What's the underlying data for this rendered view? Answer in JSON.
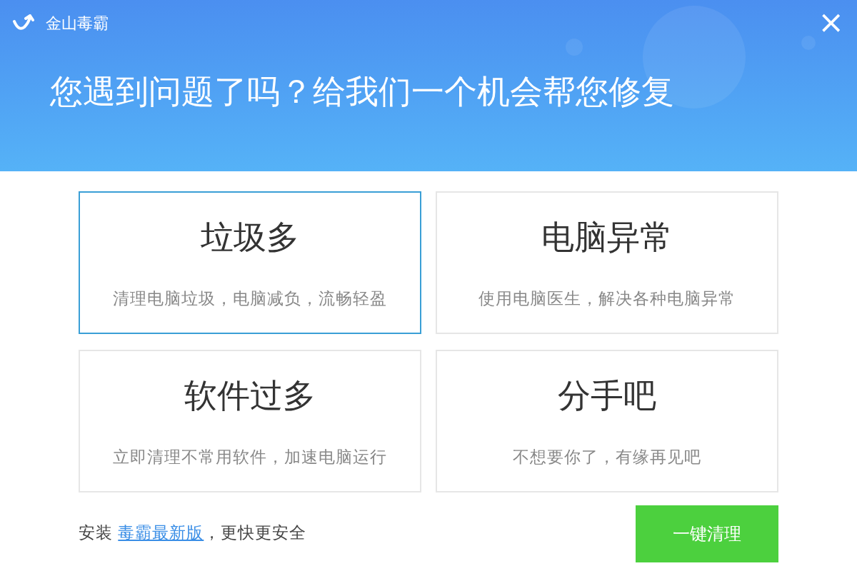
{
  "window": {
    "title": "金山毒霸",
    "close": "×"
  },
  "headline": "您遇到问题了吗？给我们一个机会帮您修复",
  "cards": [
    {
      "title": "垃圾多",
      "description": "清理电脑垃圾，电脑减负，流畅轻盈",
      "selected": true
    },
    {
      "title": "电脑异常",
      "description": "使用电脑医生，解决各种电脑异常",
      "selected": false
    },
    {
      "title": "软件过多",
      "description": "立即清理不常用软件，加速电脑运行",
      "selected": false
    },
    {
      "title": "分手吧",
      "description": "不想要你了，有缘再见吧",
      "selected": false
    }
  ],
  "footer": {
    "prefix": "安装 ",
    "link": "毒霸最新版",
    "suffix": "，更快更安全"
  },
  "button": "一键清理"
}
